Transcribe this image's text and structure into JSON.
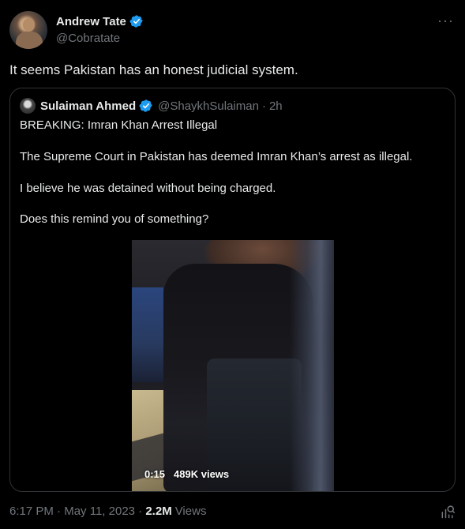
{
  "author": {
    "name": "Andrew Tate",
    "handle": "@Cobratate"
  },
  "more_icon": "more-horizontal-icon",
  "tweet": {
    "text": "It seems Pakistan has an honest judicial system."
  },
  "quoted": {
    "name": "Sulaiman Ahmed",
    "handle": "@ShaykhSulaiman",
    "separator": "·",
    "time": "2h",
    "lines": [
      "BREAKING: Imran Khan Arrest Illegal",
      "The Supreme Court in Pakistan has deemed Imran Khan’s arrest as illegal.",
      "I believe he was detained without being charged.",
      "Does this remind you of something?"
    ],
    "video": {
      "duration": "0:15",
      "views": "489K views"
    }
  },
  "footer": {
    "time": "6:17 PM",
    "separator": " · ",
    "date": "May 11, 2023",
    "separator2": " · ",
    "views_count": "2.2M",
    "views_label": "Views"
  },
  "colors": {
    "background": "#000000",
    "text": "#e7e9ea",
    "muted": "#71767b",
    "border": "#2f3336",
    "verified": "#1d9bf0"
  }
}
